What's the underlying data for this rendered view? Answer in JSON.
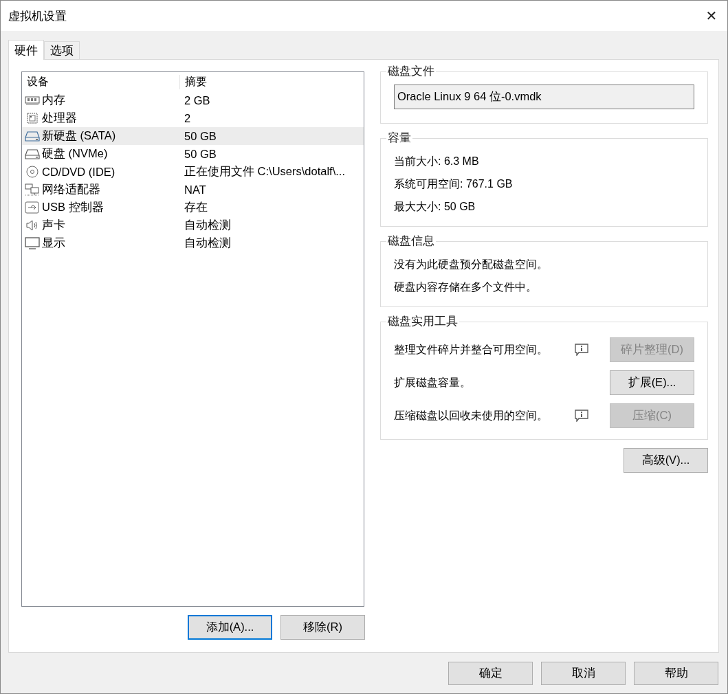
{
  "window": {
    "title": "虚拟机设置",
    "close": "✕"
  },
  "tabs": [
    {
      "label": "硬件",
      "selected": true
    },
    {
      "label": "选项",
      "selected": false
    }
  ],
  "device_table": {
    "columns": [
      "设备",
      "摘要"
    ],
    "rows": [
      {
        "kind": "memory",
        "device": "内存",
        "summary": "2 GB",
        "selected": false
      },
      {
        "kind": "cpu",
        "device": "处理器",
        "summary": "2",
        "selected": false
      },
      {
        "kind": "disk",
        "device": "新硬盘 (SATA)",
        "summary": "50 GB",
        "selected": true
      },
      {
        "kind": "disk",
        "device": "硬盘 (NVMe)",
        "summary": "50 GB",
        "selected": false
      },
      {
        "kind": "cd",
        "device": "CD/DVD (IDE)",
        "summary": "正在使用文件 C:\\Users\\dotalf\\...",
        "selected": false
      },
      {
        "kind": "network",
        "device": "网络适配器",
        "summary": "NAT",
        "selected": false
      },
      {
        "kind": "usb",
        "device": "USB 控制器",
        "summary": "存在",
        "selected": false
      },
      {
        "kind": "sound",
        "device": "声卡",
        "summary": "自动检测",
        "selected": false
      },
      {
        "kind": "display",
        "device": "显示",
        "summary": "自动检测",
        "selected": false
      }
    ]
  },
  "list_buttons": [
    {
      "label": "添加(A)...",
      "focused": true
    },
    {
      "label": "移除(R)",
      "focused": false
    }
  ],
  "disk_file": {
    "title": "磁盘文件",
    "value": "Oracle Linux 9 64 位-0.vmdk"
  },
  "capacity": {
    "title": "容量",
    "lines": [
      "当前大小: 6.3 MB",
      "系统可用空间: 767.1 GB",
      "最大大小: 50 GB"
    ]
  },
  "disk_info": {
    "title": "磁盘信息",
    "lines": [
      "没有为此硬盘预分配磁盘空间。",
      "硬盘内容存储在多个文件中。"
    ]
  },
  "disk_utilities": {
    "title": "磁盘实用工具",
    "rows": [
      {
        "text": "整理文件碎片并整合可用空间。",
        "info": true,
        "button": "碎片整理(D)",
        "disabled": true
      },
      {
        "text": "扩展磁盘容量。",
        "info": false,
        "button": "扩展(E)...",
        "disabled": false
      },
      {
        "text": "压缩磁盘以回收未使用的空间。",
        "info": true,
        "button": "压缩(C)",
        "disabled": true
      }
    ]
  },
  "advanced_button": "高级(V)...",
  "footer_buttons": [
    "确定",
    "取消",
    "帮助"
  ]
}
